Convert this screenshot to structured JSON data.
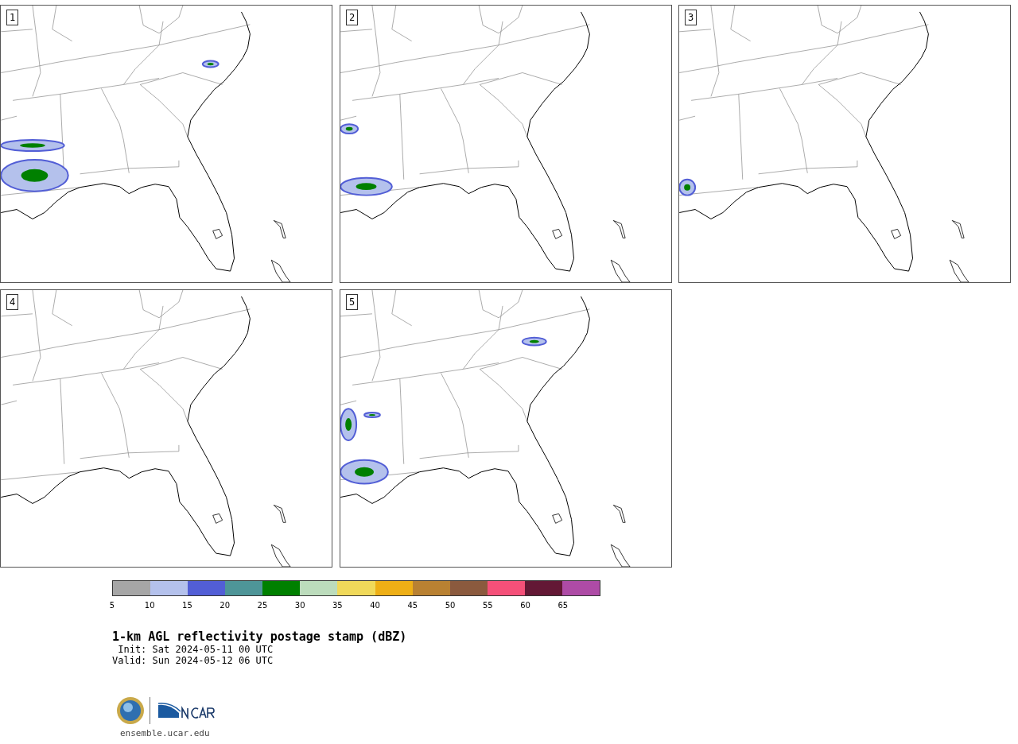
{
  "panels": [
    {
      "label": "1"
    },
    {
      "label": "2"
    },
    {
      "label": "3"
    },
    {
      "label": "4"
    },
    {
      "label": "5"
    }
  ],
  "colorbar": {
    "items": [
      {
        "color": "#a6a6a6"
      },
      {
        "color": "#b4c1ec"
      },
      {
        "color": "#525ed6"
      },
      {
        "color": "#4e9598"
      },
      {
        "color": "#008000"
      },
      {
        "color": "#bcdcbc"
      },
      {
        "color": "#f0d95a"
      },
      {
        "color": "#eeaf16"
      },
      {
        "color": "#b98132"
      },
      {
        "color": "#8b5a3e"
      },
      {
        "color": "#f55079"
      },
      {
        "color": "#631835"
      },
      {
        "color": "#ae4ba6"
      }
    ],
    "ticks": [
      "5",
      "10",
      "15",
      "20",
      "25",
      "30",
      "35",
      "40",
      "45",
      "50",
      "55",
      "60",
      "65"
    ]
  },
  "title": "1-km AGL reflectivity postage stamp (dBZ)",
  "init": " Init: Sat 2024-05-11 00 UTC",
  "valid": "Valid: Sun 2024-05-12 06 UTC",
  "footer": "ensemble.ucar.edu"
}
